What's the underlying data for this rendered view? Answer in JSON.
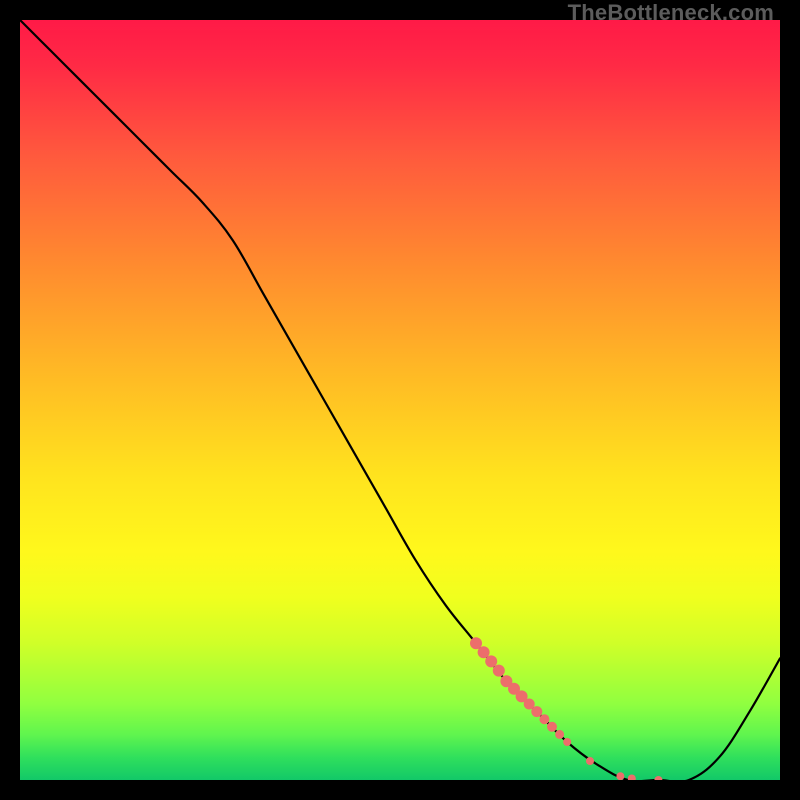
{
  "attribution": "TheBottleneck.com",
  "colors": {
    "gradient_top": "#ff1a47",
    "gradient_mid": "#ffe31e",
    "gradient_bottom": "#12c868",
    "curve": "#000000",
    "marker": "#ec6e6b",
    "background": "#000000"
  },
  "chart_data": {
    "type": "line",
    "title": "",
    "xlabel": "",
    "ylabel": "",
    "xlim": [
      0,
      100
    ],
    "ylim": [
      0,
      100
    ],
    "x": [
      0,
      4,
      8,
      12,
      16,
      20,
      24,
      28,
      32,
      36,
      40,
      44,
      48,
      52,
      56,
      60,
      64,
      68,
      72,
      76,
      80,
      84,
      88,
      92,
      96,
      100
    ],
    "y": [
      100,
      96,
      92,
      88,
      84,
      80,
      76,
      71,
      64,
      57,
      50,
      43,
      36,
      29,
      23,
      18,
      13,
      9,
      5,
      2,
      0,
      0,
      0,
      3,
      9,
      16
    ],
    "markers": [
      {
        "x": 60,
        "y": 18,
        "r": 6
      },
      {
        "x": 61,
        "y": 16.8,
        "r": 6
      },
      {
        "x": 62,
        "y": 15.6,
        "r": 6
      },
      {
        "x": 63,
        "y": 14.4,
        "r": 6
      },
      {
        "x": 64,
        "y": 13,
        "r": 6
      },
      {
        "x": 65,
        "y": 12,
        "r": 6
      },
      {
        "x": 66,
        "y": 11,
        "r": 6
      },
      {
        "x": 67,
        "y": 10,
        "r": 5.5
      },
      {
        "x": 68,
        "y": 9,
        "r": 5.5
      },
      {
        "x": 69,
        "y": 8,
        "r": 5
      },
      {
        "x": 70,
        "y": 7,
        "r": 5
      },
      {
        "x": 71,
        "y": 6,
        "r": 4.5
      },
      {
        "x": 72,
        "y": 5,
        "r": 4
      },
      {
        "x": 75,
        "y": 2.5,
        "r": 4
      },
      {
        "x": 79,
        "y": 0.5,
        "r": 4
      },
      {
        "x": 80.5,
        "y": 0.2,
        "r": 4
      },
      {
        "x": 84,
        "y": 0,
        "r": 4
      }
    ]
  }
}
